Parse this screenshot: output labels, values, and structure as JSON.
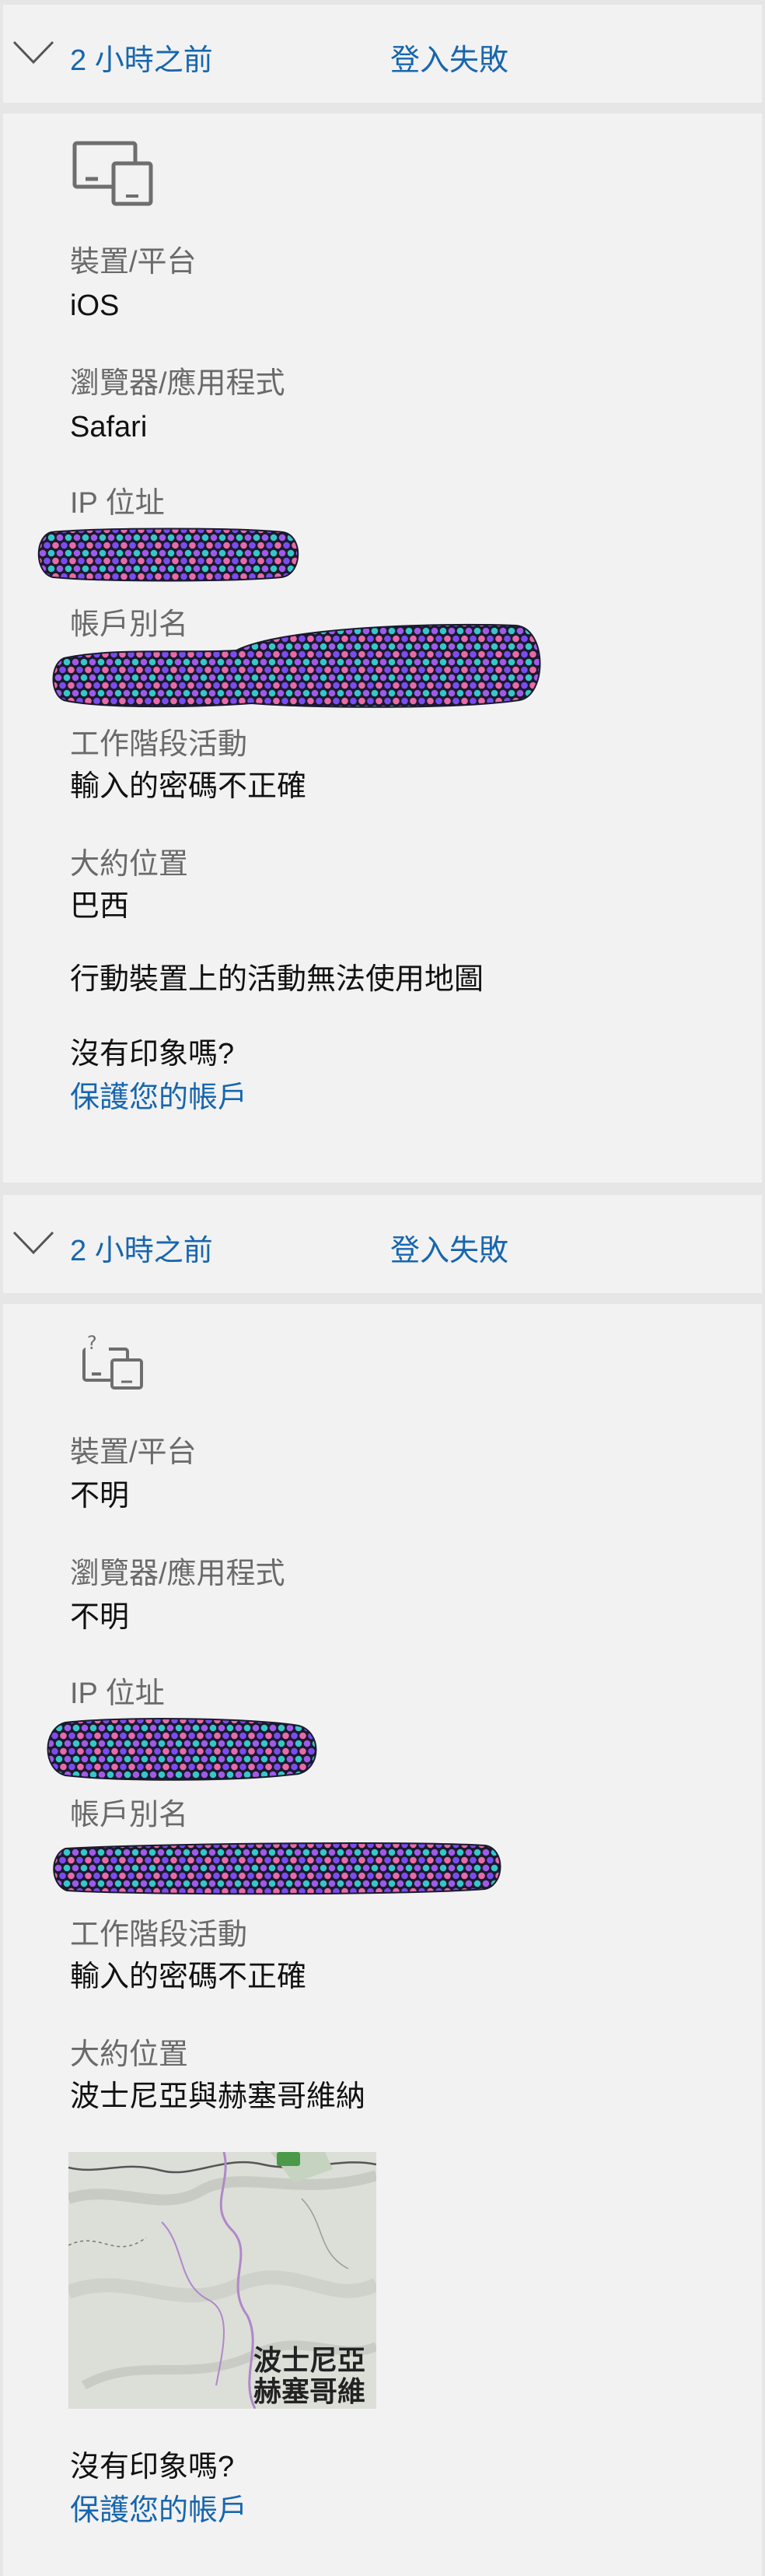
{
  "entries": [
    {
      "time": "2 小時之前",
      "status": "登入失敗",
      "device_icon": "devices-icon",
      "fields": {
        "device_label": "裝置/平台",
        "device_value": "iOS",
        "browser_label": "瀏覽器/應用程式",
        "browser_value": "Safari",
        "ip_label": "IP 位址",
        "alias_label": "帳戶別名",
        "activity_label": "工作階段活動",
        "activity_value": "輸入的密碼不正確",
        "location_label": "大約位置",
        "location_value": "巴西"
      },
      "map_unavailable": "行動裝置上的活動無法使用地圖",
      "prompt": "沒有印象嗎?",
      "protect_link": "保護您的帳戶"
    },
    {
      "time": "2 小時之前",
      "status": "登入失敗",
      "device_icon": "unknown-device-icon",
      "fields": {
        "device_label": "裝置/平台",
        "device_value": "不明",
        "browser_label": "瀏覽器/應用程式",
        "browser_value": "不明",
        "ip_label": "IP 位址",
        "alias_label": "帳戶別名",
        "activity_label": "工作階段活動",
        "activity_value": "輸入的密碼不正確",
        "location_label": "大約位置",
        "location_value": "波士尼亞與赫塞哥維納"
      },
      "map_labels": [
        "波士尼亞",
        "赫塞哥維"
      ],
      "prompt": "沒有印象嗎?",
      "protect_link": "保護您的帳戶"
    }
  ],
  "colors": {
    "accent": "#1766ae",
    "panel": "#f2f2f2",
    "page": "#e6e6e6"
  }
}
